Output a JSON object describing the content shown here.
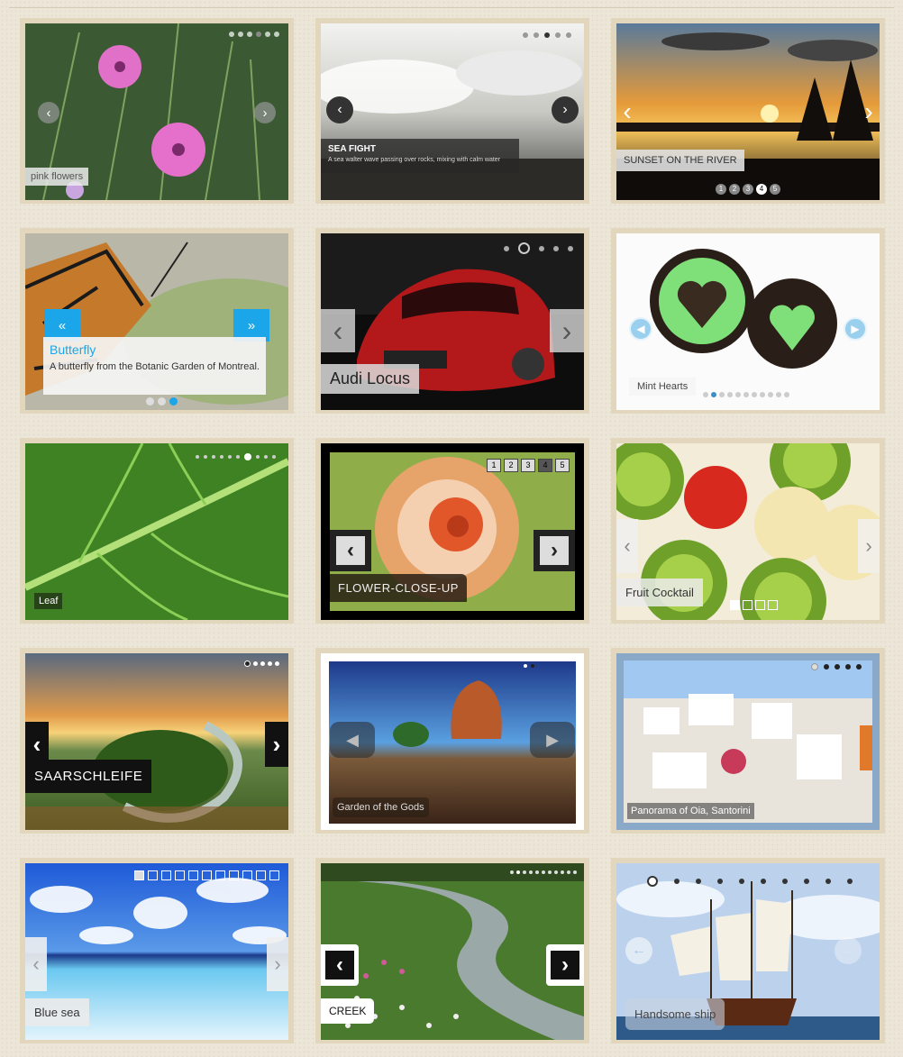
{
  "slides": [
    {
      "caption": "pink flowers"
    },
    {
      "caption": "SEA FIGHT",
      "sub": "A sea walter wave passing over rocks, mixing with calm water"
    },
    {
      "caption": "SUNSET ON THE RIVER",
      "numbers": [
        "1",
        "2",
        "3",
        "4",
        "5"
      ]
    },
    {
      "caption": "Butterfly",
      "sub": "A butterfly from the Botanic Garden of Montreal."
    },
    {
      "caption": "Audi Locus"
    },
    {
      "caption": "Mint Hearts"
    },
    {
      "caption": "Leaf"
    },
    {
      "caption": "FLOWER-CLOSE-UP",
      "numbers": [
        "1",
        "2",
        "3",
        "4",
        "5"
      ]
    },
    {
      "caption": "Fruit Cocktail"
    },
    {
      "caption": "SAARSCHLEIFE"
    },
    {
      "caption": "Garden of the Gods"
    },
    {
      "caption": "Panorama of Oia, Santorini"
    },
    {
      "caption": "Blue sea"
    },
    {
      "caption": "CREEK"
    },
    {
      "caption": "Handsome ship"
    }
  ],
  "colors": {
    "frame": "#e2d7bd",
    "accent_blue": "#1aa6e8",
    "background": "#ece6d8"
  }
}
